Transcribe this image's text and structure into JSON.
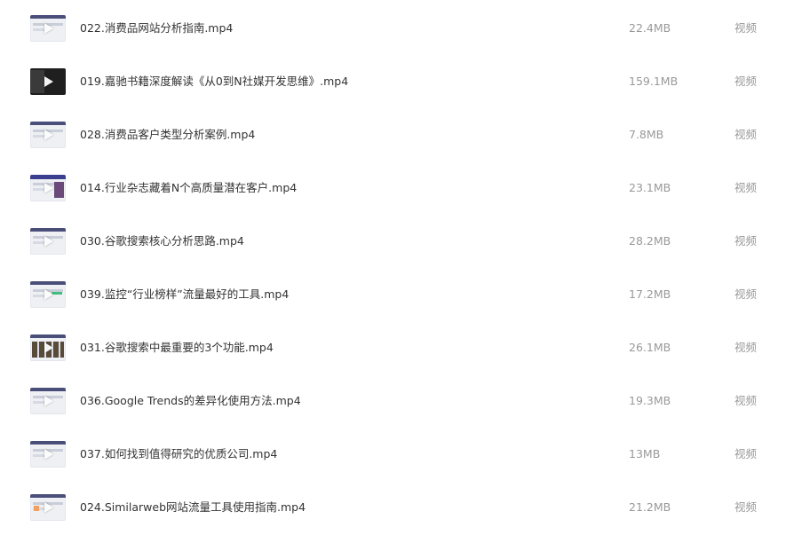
{
  "files": [
    {
      "name": "022.消费品网站分析指南.mp4",
      "size": "22.4MB",
      "type": "视频",
      "thumb": "default-video-thumbnail"
    },
    {
      "name": "019.嘉驰书籍深度解读《从0到N社媒开发思维》.mp4",
      "size": "159.1MB",
      "type": "视频",
      "thumb": "dark-video-thumbnail"
    },
    {
      "name": "028.消费品客户类型分析案例.mp4",
      "size": "7.8MB",
      "type": "视频",
      "thumb": "default-video-thumbnail"
    },
    {
      "name": "014.行业杂志藏着N个高质量潜在客户.mp4",
      "size": "23.1MB",
      "type": "视频",
      "thumb": "purple-video-thumbnail"
    },
    {
      "name": "030.谷歌搜索核心分析思路.mp4",
      "size": "28.2MB",
      "type": "视频",
      "thumb": "default-video-thumbnail"
    },
    {
      "name": "039.监控“行业榜样”流量最好的工具.mp4",
      "size": "17.2MB",
      "type": "视频",
      "thumb": "green-video-thumbnail"
    },
    {
      "name": "031.谷歌搜索中最重要的3个功能.mp4",
      "size": "26.1MB",
      "type": "视频",
      "thumb": "grid-video-thumbnail"
    },
    {
      "name": "036.Google Trends的差异化使用方法.mp4",
      "size": "19.3MB",
      "type": "视频",
      "thumb": "default-video-thumbnail"
    },
    {
      "name": "037.如何找到值得研究的优质公司.mp4",
      "size": "13MB",
      "type": "视频",
      "thumb": "default-video-thumbnail"
    },
    {
      "name": "024.Similarweb网站流量工具使用指南.mp4",
      "size": "21.2MB",
      "type": "视频",
      "thumb": "orange-video-thumbnail"
    }
  ]
}
